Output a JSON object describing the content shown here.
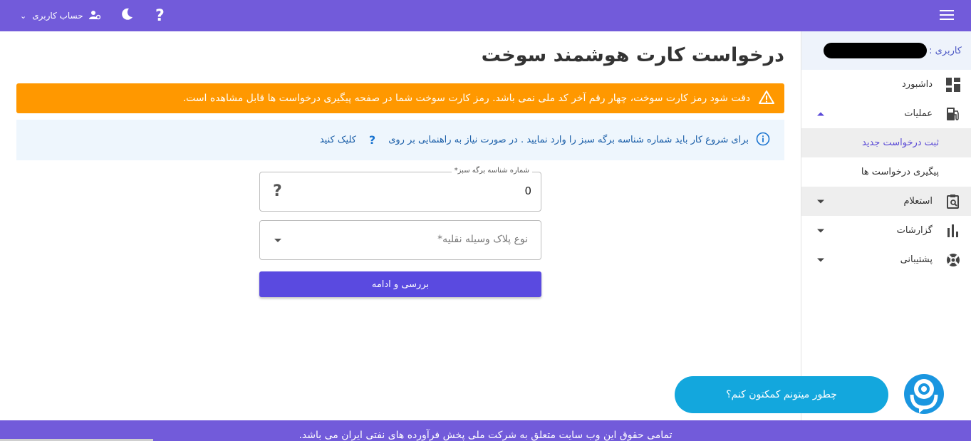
{
  "topbar": {
    "account_label": "حساب کاربری",
    "help_symbol": "?"
  },
  "sidebar": {
    "user_label": "کاربری :",
    "items": [
      {
        "label": "داشبورد"
      },
      {
        "label": "عملیات"
      },
      {
        "label": "ثبت درخواست جدید"
      },
      {
        "label": "پیگیری درخواست ها"
      },
      {
        "label": "استعلام"
      },
      {
        "label": "گزارشات"
      },
      {
        "label": "پشتیبانی"
      }
    ]
  },
  "main": {
    "title": "درخواست کارت هوشمند سوخت",
    "warning": "دقت شود رمز کارت سوخت، چهار رقم آخر کد ملی نمی باشد. رمز کارت سوخت شما در صفحه پیگیری درخواست ها قابل مشاهده است.",
    "info_text": "برای شروع کار باید شماره شناسه برگه سبز را وارد نمایید . در صورت نیاز به راهنمایی بر روی",
    "info_qmark": "?",
    "info_link": "کلیک کنید",
    "form": {
      "green_sheet_label": "شماره شناسه برگه سبز*",
      "green_sheet_value": "0",
      "help_symbol": "?",
      "plate_type_placeholder": "نوع پلاک وسیله نقلیه*",
      "submit_label": "بررسی و ادامه"
    }
  },
  "chat": {
    "bubble_text": "چطور میتونم کمکتون کنم؟"
  },
  "footer": {
    "text": "تمامی حقوق این وب سایت متعلق به شرکت ملی پخش فرآورده های نفتی ایران می باشد."
  },
  "colors": {
    "primary": "#725bda",
    "button": "#5a4ae0",
    "warning": "#ff9800",
    "info_bg": "#eef6fd",
    "chat": "#13a7dd"
  }
}
